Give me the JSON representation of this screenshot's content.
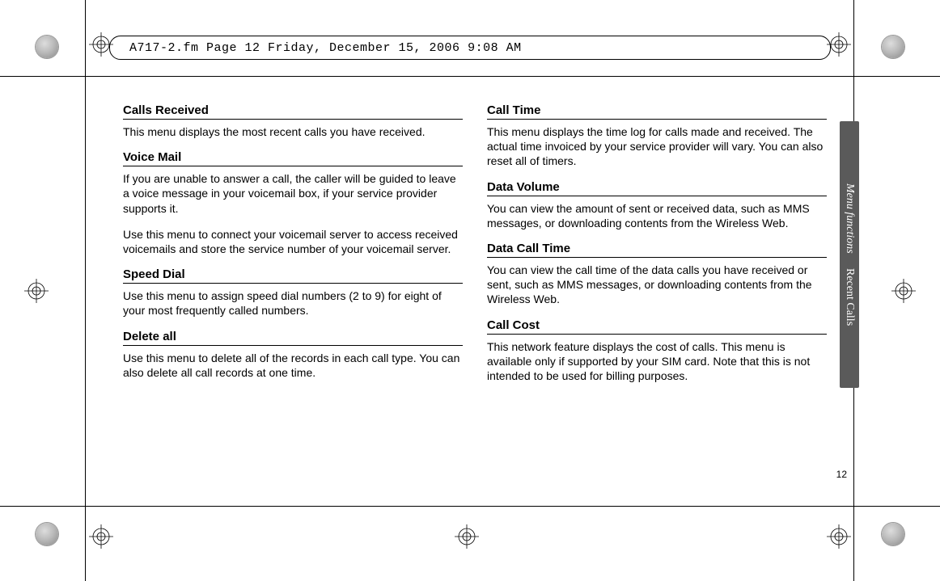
{
  "header": "A717-2.fm  Page 12  Friday, December 15, 2006  9:08 AM",
  "page_number": "12",
  "side_tab": {
    "l1": "Menu functions",
    "l2": "Recent Calls"
  },
  "left": {
    "s1": {
      "title": "Calls Received",
      "p1": "This menu displays the most recent calls you have received."
    },
    "s2": {
      "title": "Voice Mail",
      "p1": "If you are unable to answer a call, the caller will be guided to leave a voice message in your voicemail box, if your service provider supports it.",
      "p2": "Use this menu to connect your voicemail server to access received voicemails and store the service number of your voicemail server."
    },
    "s3": {
      "title": "Speed Dial",
      "p1": "Use this menu to assign speed dial numbers (2 to 9) for eight of your most frequently called numbers."
    },
    "s4": {
      "title": "Delete all",
      "p1": "Use this menu to delete all of the records in each call type. You can also delete all call records at one time."
    }
  },
  "right": {
    "s1": {
      "title": "Call Time",
      "p1": "This menu displays the time log for calls made and received. The actual time invoiced by your service provider will vary. You can also reset all of timers."
    },
    "s2": {
      "title": "Data Volume",
      "p1": "You can view the amount of sent or received data, such as MMS messages, or downloading contents from the Wireless Web."
    },
    "s3": {
      "title": "Data Call Time",
      "p1": "You can view the call time of the data calls you have received or sent, such as MMS messages, or downloading contents from the Wireless Web."
    },
    "s4": {
      "title": "Call Cost",
      "p1": "This network feature displays the cost of calls. This menu is available only if supported by your SIM card. Note that this is not intended to be used for billing purposes."
    }
  }
}
